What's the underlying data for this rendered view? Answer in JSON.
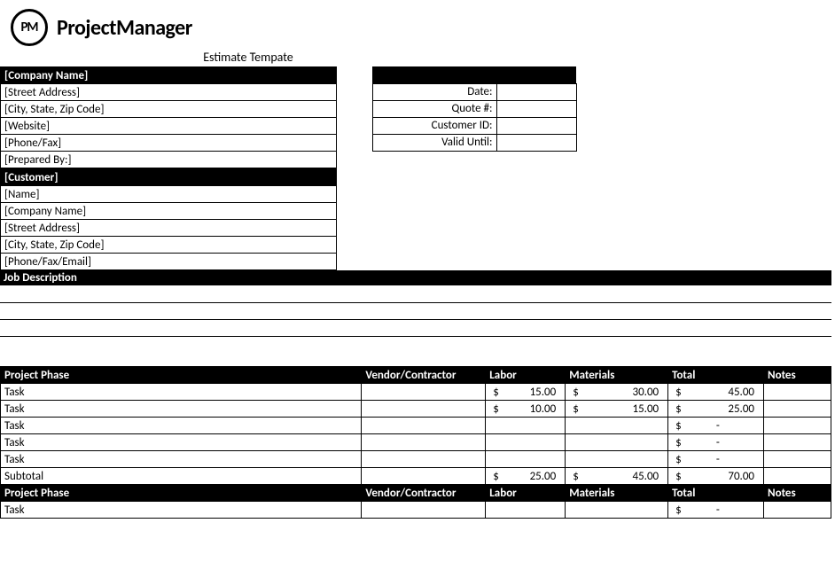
{
  "logo": {
    "abbr": "PM",
    "brand": "ProjectManager"
  },
  "title": "Estimate Tempate",
  "company": {
    "header": "[Company Name]",
    "fields": [
      "[Street Address]",
      "[City, State, Zip Code]",
      "[Website]",
      "[Phone/Fax]",
      "[Prepared By:]"
    ]
  },
  "details": {
    "labels": [
      "Date:",
      "Quote #:",
      "Customer ID:",
      "Valid Until:"
    ],
    "values": [
      "",
      "",
      "",
      ""
    ]
  },
  "customer": {
    "header": "[Customer]",
    "fields": [
      "[Name]",
      "[Company Name]",
      "[Street Address]",
      "[City, State, Zip Code]",
      "[Phone/Fax/Email]"
    ]
  },
  "job_description": {
    "header": "Job Description",
    "lines": [
      "",
      "",
      ""
    ]
  },
  "phase_headers": [
    "Project Phase",
    "Vendor/Contractor",
    "Labor",
    "Materials",
    "Total",
    "Notes"
  ],
  "phase1": {
    "rows": [
      {
        "task": "Task",
        "vendor": "",
        "labor": "15.00",
        "materials": "30.00",
        "total": "45.00",
        "notes": ""
      },
      {
        "task": "Task",
        "vendor": "",
        "labor": "10.00",
        "materials": "15.00",
        "total": "25.00",
        "notes": ""
      },
      {
        "task": "Task",
        "vendor": "",
        "labor": "",
        "materials": "",
        "total": "-",
        "notes": ""
      },
      {
        "task": "Task",
        "vendor": "",
        "labor": "",
        "materials": "",
        "total": "-",
        "notes": ""
      },
      {
        "task": "Task",
        "vendor": "",
        "labor": "",
        "materials": "",
        "total": "-",
        "notes": ""
      }
    ],
    "subtotal": {
      "label": "Subtotal",
      "labor": "25.00",
      "materials": "45.00",
      "total": "70.00"
    }
  },
  "phase2": {
    "rows": [
      {
        "task": "Task",
        "vendor": "",
        "labor": "",
        "materials": "",
        "total": "-",
        "notes": ""
      }
    ]
  },
  "currency": "$"
}
